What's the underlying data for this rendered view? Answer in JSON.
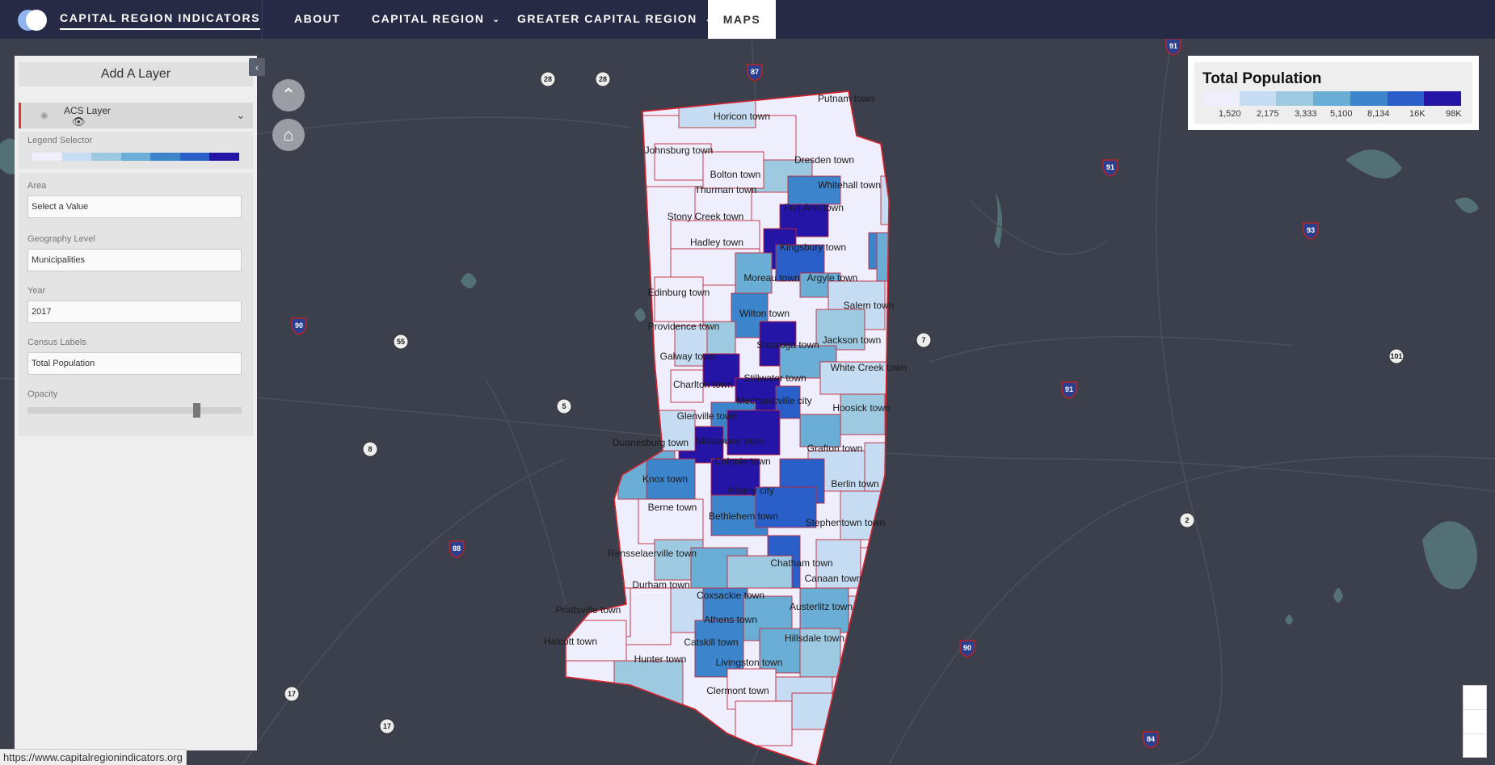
{
  "nav": {
    "brand": "CAPITAL REGION INDICATORS",
    "items": [
      {
        "label": "ABOUT"
      },
      {
        "label": "CAPITAL REGION"
      },
      {
        "label": "GREATER CAPITAL REGION"
      }
    ],
    "active": "MAPS"
  },
  "sidebar": {
    "header": "Add A Layer",
    "layer_name": "ACS Layer",
    "legend_selector_label": "Legend Selector",
    "area_label": "Area",
    "area_value": "Select a Value",
    "geo_label": "Geography Level",
    "geo_value": "Municipalities",
    "year_label": "Year",
    "year_value": "2017",
    "census_label": "Census Labels",
    "census_value": "Total Population",
    "opacity_label": "Opacity",
    "opacity_value": 0.8
  },
  "legend": {
    "title": "Total Population",
    "ticks": [
      "1,520",
      "2,175",
      "3,333",
      "5,100",
      "8,134",
      "16K",
      "98K"
    ],
    "colors": [
      "#eeeefc",
      "#c6dcf2",
      "#9ecae1",
      "#6aaed6",
      "#3c84cb",
      "#2a5ec8",
      "#2515a6"
    ]
  },
  "status_url": "https://www.capitalregionindicators.org",
  "shields": [
    "91",
    "87",
    "28",
    "28",
    "91",
    "93",
    "90",
    "55",
    "7",
    "101",
    "91",
    "5",
    "8",
    "88",
    "2",
    "90",
    "17",
    "17",
    "84"
  ],
  "towns": [
    "Putnam town",
    "Horicon town",
    "Johnsburg town",
    "Dresden town",
    "Bolton town",
    "Whitehall town",
    "Thurman town",
    "Fort Ann town",
    "Stony Creek town",
    "Hadley town",
    "Kingsbury town",
    "Moreau town",
    "Argyle town",
    "Edinburg town",
    "Salem town",
    "Wilton town",
    "Providence town",
    "Jackson town",
    "Saratoga town",
    "Galway town",
    "White Creek town",
    "Stillwater town",
    "Charlton town",
    "Mechanicville city",
    "Hoosick town",
    "Glenville town",
    "Duanesburg town",
    "Niskayuna town",
    "Grafton town",
    "Colonie town",
    "Knox town",
    "Berlin town",
    "Albany city",
    "Berne town",
    "Bethlehem town",
    "Stephentown town",
    "Rensselaerville town",
    "Chatham town",
    "Canaan town",
    "Durham town",
    "Coxsackie town",
    "Prattsville town",
    "Austerlitz town",
    "Athens town",
    "Hillsdale town",
    "Halcott town",
    "Catskill town",
    "Hunter town",
    "Livingston town",
    "Clermont town"
  ]
}
